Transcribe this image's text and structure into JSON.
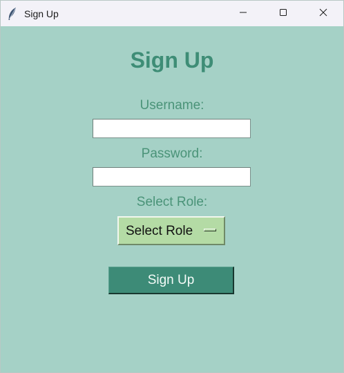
{
  "window": {
    "title": "Sign Up",
    "icon": "feather-icon",
    "controls": [
      "minimize-icon",
      "maximize-icon",
      "close-icon"
    ]
  },
  "form": {
    "heading": "Sign Up",
    "username_label": "Username:",
    "username_value": "",
    "password_label": "Password:",
    "password_value": "",
    "role_label": "Select Role:",
    "role_selected": "Select Role",
    "submit_label": "Sign Up"
  },
  "colors": {
    "background": "#a5d1c6",
    "heading": "#3e8d76",
    "label": "#4a9378",
    "option_menu": "#b4dba5",
    "button": "#3d8b77",
    "button_text": "#f4fbf8"
  }
}
